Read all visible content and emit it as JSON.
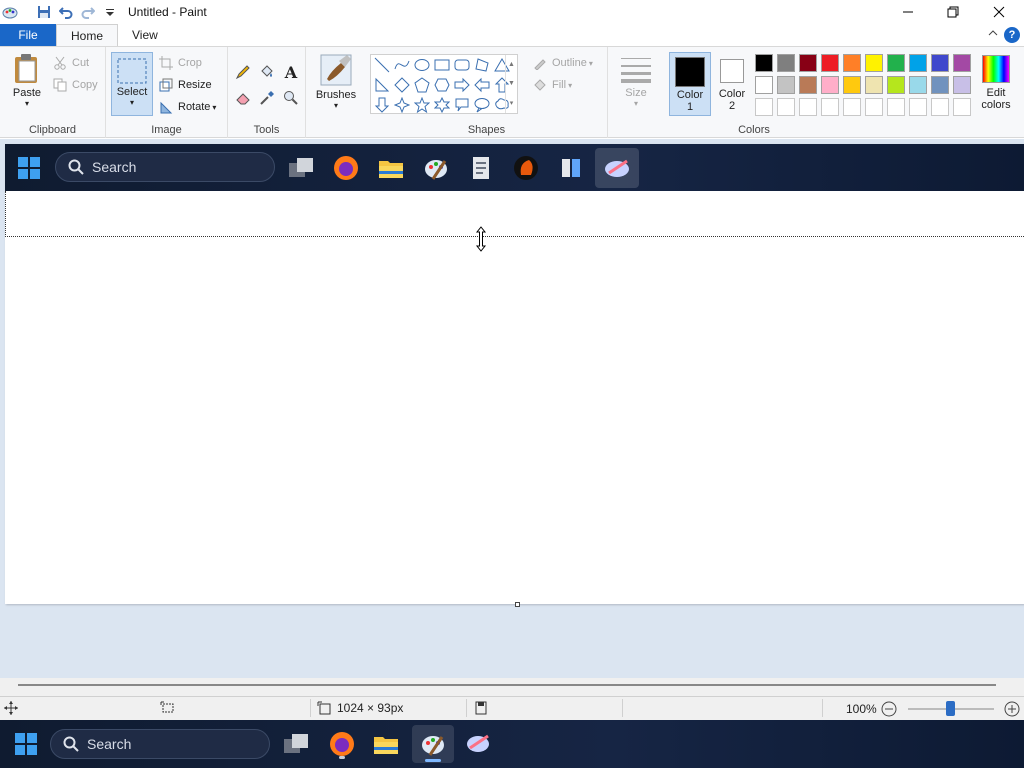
{
  "window": {
    "title": "Untitled - Paint"
  },
  "menu": {
    "file": "File",
    "home": "Home",
    "view": "View",
    "help": "?"
  },
  "ribbon": {
    "clipboard": {
      "paste": "Paste",
      "cut": "Cut",
      "copy": "Copy",
      "label": "Clipboard"
    },
    "image": {
      "select": "Select",
      "crop": "Crop",
      "resize": "Resize",
      "rotate": "Rotate",
      "label": "Image"
    },
    "tools": {
      "label": "Tools"
    },
    "brushes": {
      "label": "Brushes"
    },
    "shapes": {
      "outline": "Outline",
      "fill": "Fill",
      "label": "Shapes"
    },
    "size": {
      "label": "Size"
    },
    "colors": {
      "color1": "Color",
      "color1_num": "1",
      "color2": "Color",
      "color2_num": "2",
      "label": "Colors",
      "edit": "Edit",
      "edit2": "colors",
      "palette_row1": [
        "#000000",
        "#7f7f7f",
        "#880015",
        "#ed1c24",
        "#ff7f27",
        "#fff200",
        "#22b14c",
        "#00a2e8",
        "#3f48cc",
        "#a349a4"
      ],
      "palette_row2": [
        "#ffffff",
        "#c3c3c3",
        "#b97a57",
        "#ffaec9",
        "#ffc90e",
        "#efe4b0",
        "#b5e61d",
        "#99d9ea",
        "#7092be",
        "#c8bfe7"
      ],
      "palette_row3": [
        "#ffffff",
        "#ffffff",
        "#ffffff",
        "#ffffff",
        "#ffffff",
        "#ffffff",
        "#ffffff",
        "#ffffff",
        "#ffffff",
        "#ffffff"
      ],
      "primary": "#000000",
      "secondary": "#ffffff"
    }
  },
  "canvas_taskbar": {
    "search_placeholder": "Search"
  },
  "statusbar": {
    "dimensions": "1024 × 93px",
    "zoom": "100%"
  },
  "taskbar": {
    "search_placeholder": "Search"
  }
}
